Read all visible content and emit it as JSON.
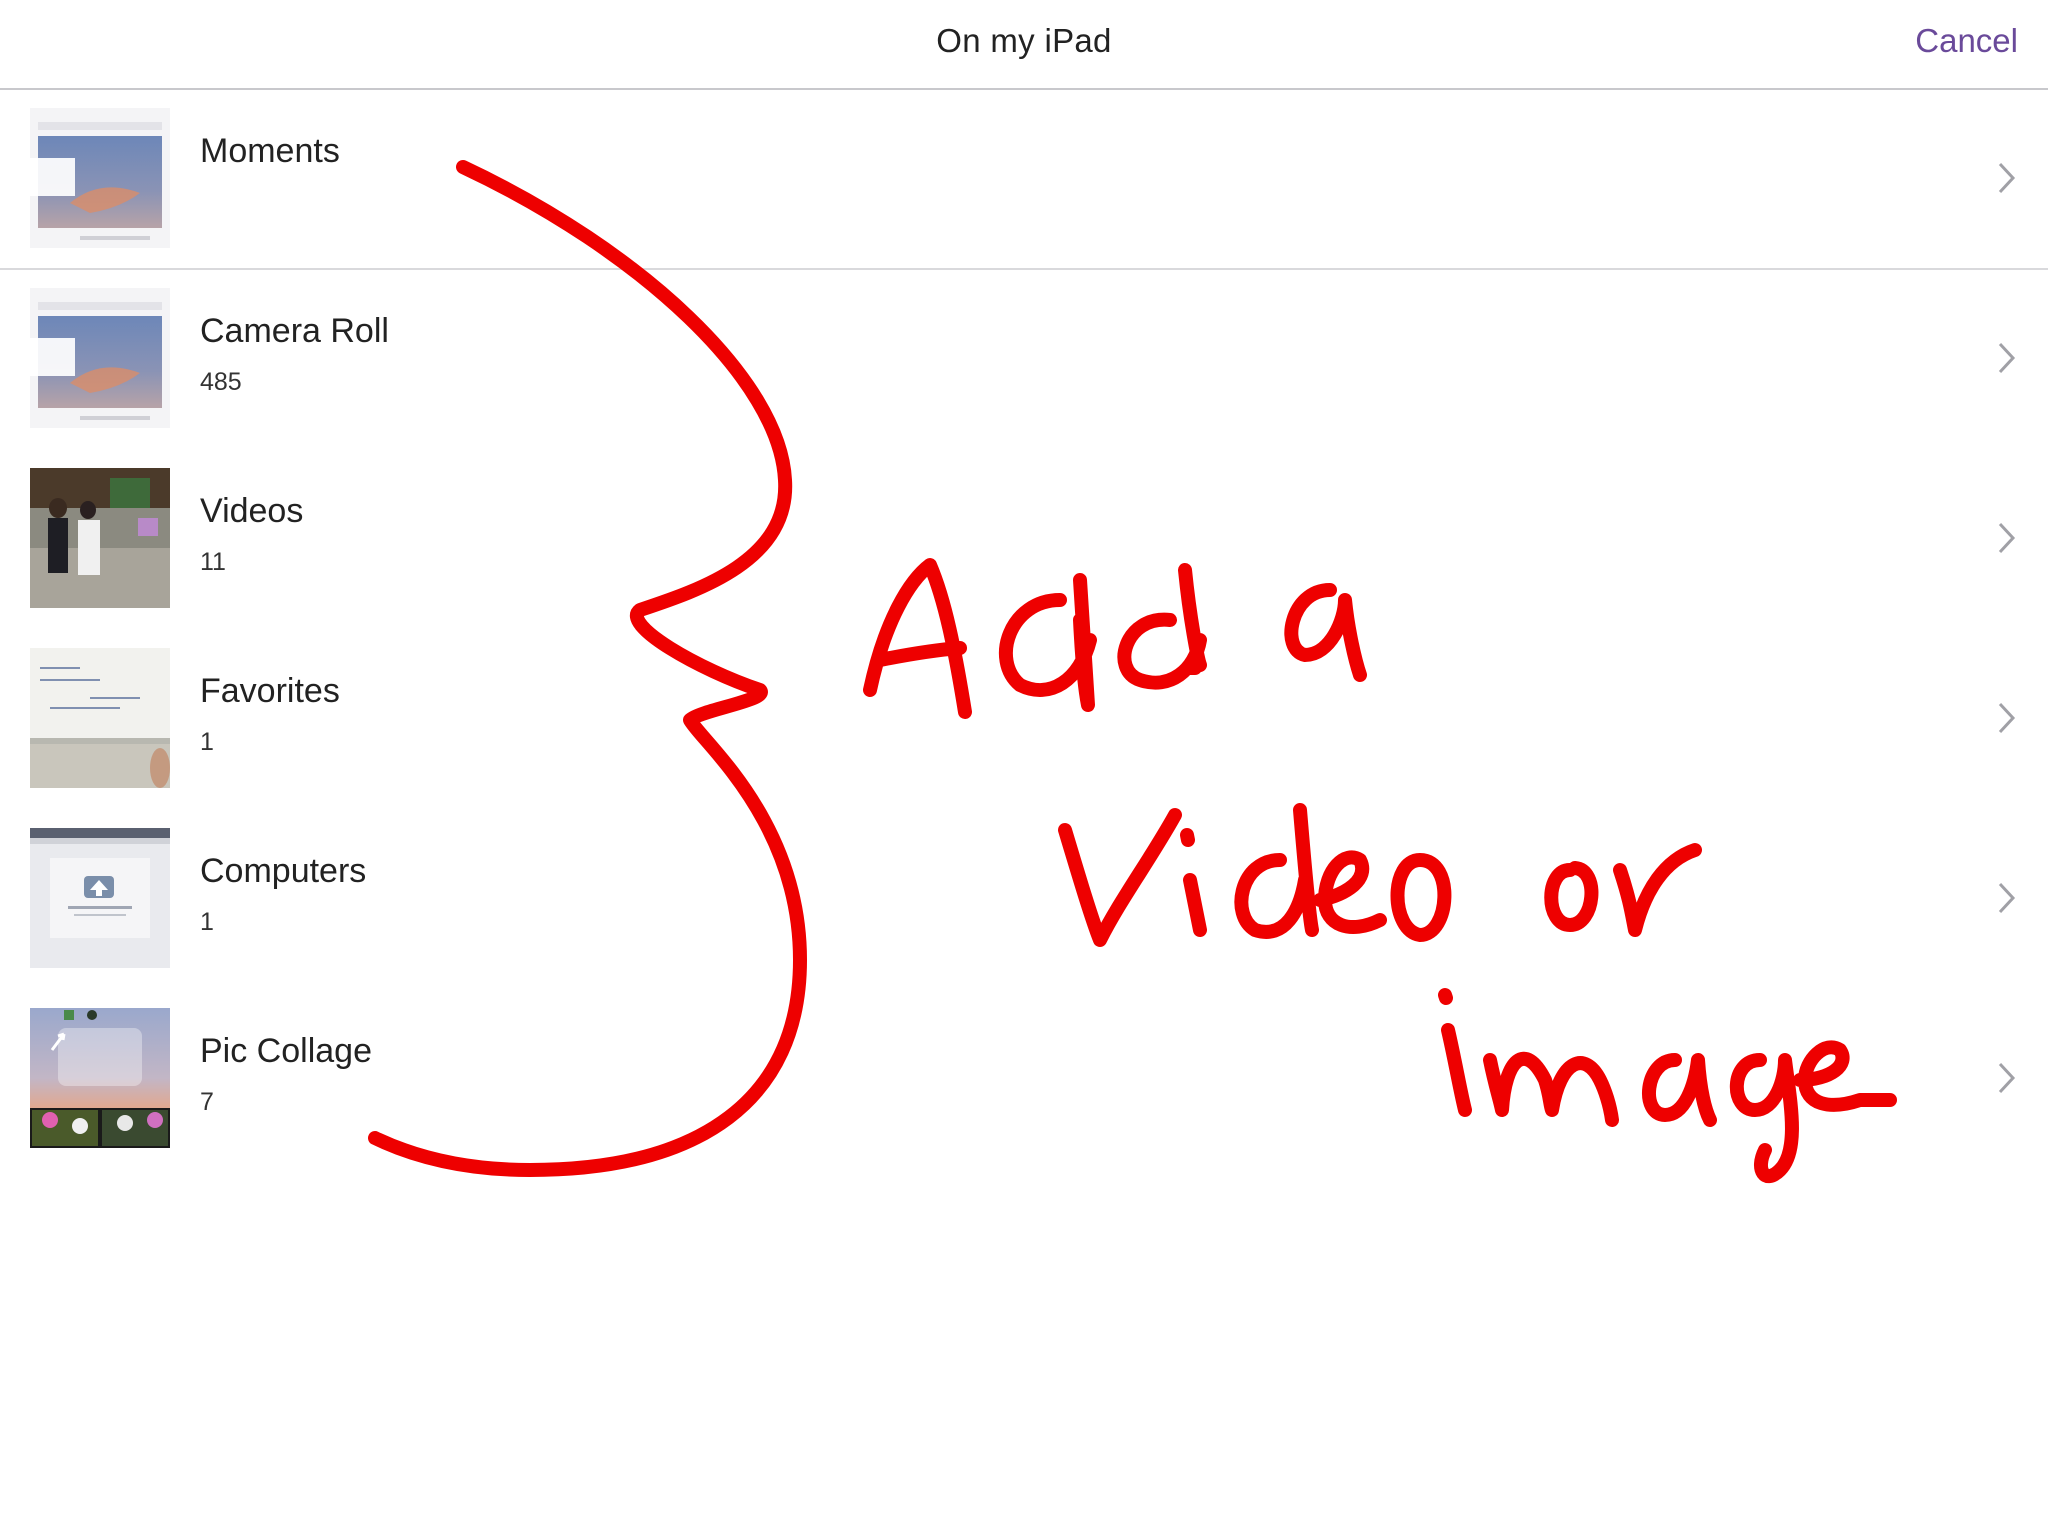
{
  "navbar": {
    "title": "On my iPad",
    "cancel_label": "Cancel"
  },
  "albums": [
    {
      "name": "Moments",
      "count": ""
    },
    {
      "name": "Camera Roll",
      "count": "485"
    },
    {
      "name": "Videos",
      "count": "11"
    },
    {
      "name": "Favorites",
      "count": "1"
    },
    {
      "name": "Computers",
      "count": "1"
    },
    {
      "name": "Pic Collage",
      "count": "7"
    }
  ],
  "annotation": {
    "text_lines": [
      "Add a",
      "Video or",
      "image"
    ],
    "color": "#ee0000"
  },
  "colors": {
    "accent": "#6a4a9a",
    "separator": "#c8c8cc"
  }
}
